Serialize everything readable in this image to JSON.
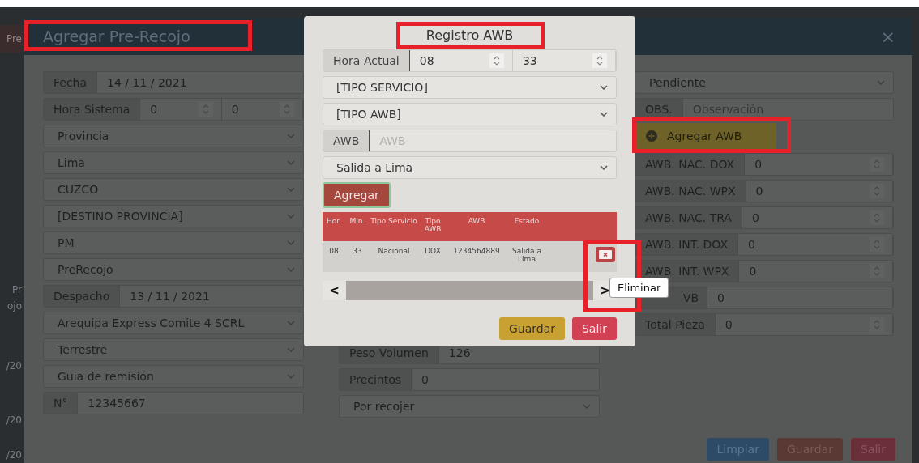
{
  "background_page": {
    "fragments": [
      {
        "text": "Pre",
        "kind": "band"
      },
      {
        "text": "Pr",
        "kind": "plain"
      },
      {
        "text": "ojo",
        "kind": "plain"
      },
      {
        "text": "/20",
        "kind": "plain"
      },
      {
        "text": "/20",
        "kind": "plain"
      },
      {
        "text": "/20",
        "kind": "plain"
      }
    ]
  },
  "dialog": {
    "title": "Agregar Pre-Recojo",
    "close": "×",
    "left_column": [
      {
        "kind": "input",
        "label": "Fecha",
        "value": "14 / 11 / 2021"
      },
      {
        "kind": "time",
        "label": "Hora Sistema",
        "hour": "0",
        "minute": "0"
      },
      {
        "kind": "select",
        "value": "Provincia"
      },
      {
        "kind": "select",
        "value": "Lima"
      },
      {
        "kind": "select",
        "value": "CUZCO"
      },
      {
        "kind": "select",
        "value": "[DESTINO PROVINCIA]"
      },
      {
        "kind": "select",
        "value": "PM"
      },
      {
        "kind": "select",
        "value": "PreRecojo"
      },
      {
        "kind": "input",
        "label": "Despacho",
        "value": "13 / 11 / 2021"
      },
      {
        "kind": "select",
        "value": "Arequipa Express Comite 4 SCRL"
      },
      {
        "kind": "select",
        "value": "Terrestre"
      },
      {
        "kind": "select",
        "value": "Guia de remisión"
      },
      {
        "kind": "input",
        "label": "N°",
        "value": "12345667"
      }
    ],
    "middle_column": [
      {
        "kind": "input",
        "label": "Peso Volumen",
        "value": "126"
      },
      {
        "kind": "input",
        "label": "Precintos",
        "value": "0"
      },
      {
        "kind": "select",
        "value": "Por recojer"
      }
    ],
    "right_column": [
      {
        "kind": "select",
        "value": "Pendiente"
      },
      {
        "kind": "input",
        "label": "OBS.",
        "placeholder": "Observación"
      },
      {
        "kind": "button",
        "label": "Agregar AWB"
      },
      {
        "kind": "number",
        "label": "AWB. NAC. DOX",
        "value": "0"
      },
      {
        "kind": "number",
        "label": "AWB. NAC. WPX",
        "value": "0"
      },
      {
        "kind": "number",
        "label": "AWB. NAC. TRA",
        "value": "0"
      },
      {
        "kind": "number",
        "label": "AWB. INT. DOX",
        "value": "0"
      },
      {
        "kind": "number",
        "label": "AWB. INT. WPX",
        "value": "0"
      },
      {
        "kind": "partial",
        "label": "VB",
        "value": "0"
      },
      {
        "kind": "number",
        "label": "Total Pieza",
        "value": "0"
      }
    ],
    "buttons": [
      {
        "label": "Limpiar",
        "kind": "info"
      },
      {
        "label": "Guardar",
        "kind": "dark"
      },
      {
        "label": "Salir",
        "kind": "danger"
      }
    ]
  },
  "awb_dialog": {
    "title": "Registro AWB",
    "hour_row": {
      "label": "Hora Actual",
      "hour": "08",
      "minute": "33"
    },
    "fields": [
      {
        "kind": "select",
        "value": "[TIPO SERVICIO]"
      },
      {
        "kind": "select",
        "value": "[TIPO AWB]"
      },
      {
        "kind": "input",
        "label": "AWB",
        "placeholder": "AWB"
      },
      {
        "kind": "select",
        "value": "Salida a Lima"
      }
    ],
    "add_button": "Agregar",
    "table": {
      "columns": [
        "Hor.",
        "Min.",
        "Tipo Servicio",
        "Tipo AWB",
        "AWB",
        "Estado"
      ],
      "rows": [
        {
          "cells": [
            "08",
            "33",
            "Nacional",
            "DOX",
            "1234564889",
            "Salida a Lima"
          ]
        }
      ]
    },
    "scroll": {
      "left": "<",
      "right": ">"
    },
    "buttons": [
      {
        "label": "Guardar",
        "kind": "warning"
      },
      {
        "label": "Salir",
        "kind": "danger"
      }
    ]
  },
  "tooltip": {
    "text": "Eliminar"
  }
}
